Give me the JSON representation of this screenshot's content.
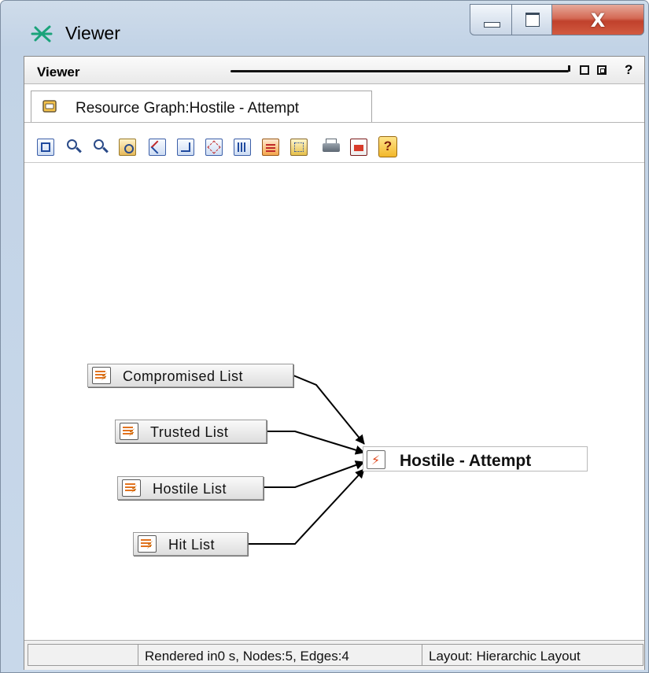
{
  "window": {
    "title": "Viewer",
    "close_label": "X"
  },
  "panel": {
    "title": "Viewer",
    "help": "?"
  },
  "tab": {
    "label": "Resource Graph:Hostile - Attempt"
  },
  "toolbar": {
    "buttons": [
      {
        "name": "fit-content",
        "icon": "fit-content-icon"
      },
      {
        "name": "zoom-in",
        "icon": "zoom-in-icon"
      },
      {
        "name": "zoom-out",
        "icon": "zoom-out-icon"
      },
      {
        "name": "interactive-zoom",
        "icon": "zoom-area-icon"
      },
      {
        "name": "hierarchic-layout",
        "icon": "hierarchic-layout-icon"
      },
      {
        "name": "tree-layout",
        "icon": "tree-layout-icon"
      },
      {
        "name": "organic-layout",
        "icon": "organic-layout-icon"
      },
      {
        "name": "orthogonal-layout",
        "icon": "orthogonal-layout-icon"
      },
      {
        "name": "circular-layout",
        "icon": "circular-layout-icon"
      },
      {
        "name": "grid-layout",
        "icon": "grid-layout-icon"
      },
      {
        "name": "print",
        "icon": "printer-icon"
      },
      {
        "name": "export",
        "icon": "export-icon"
      },
      {
        "name": "help",
        "icon": "help-icon",
        "label": "?"
      }
    ]
  },
  "graph": {
    "sources": [
      {
        "label": "Compromised List",
        "icon": "active-list-icon"
      },
      {
        "label": "Trusted List",
        "icon": "active-list-icon"
      },
      {
        "label": "Hostile List",
        "icon": "active-list-icon"
      },
      {
        "label": "Hit List",
        "icon": "active-list-icon"
      }
    ],
    "target": {
      "label": "Hostile - Attempt",
      "icon": "rule-icon"
    },
    "edge_color": "#000000"
  },
  "status": {
    "render": "Rendered in0 s, Nodes:5, Edges:4",
    "layout": "Layout: Hierarchic Layout"
  },
  "colors": {
    "close_button": "#c94a32",
    "window_frame": "#c8d8ea",
    "node_fill": "#e6e6e6"
  }
}
